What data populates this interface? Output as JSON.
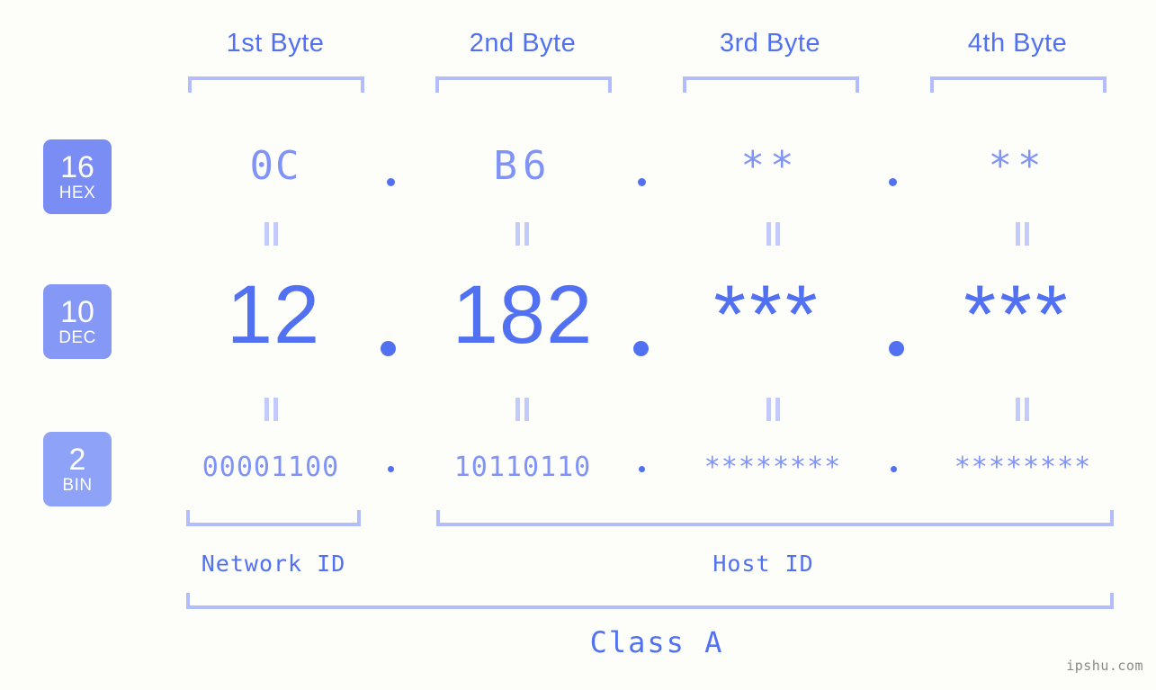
{
  "background_color": "#fdfdfa",
  "accent_color": "#5271f2",
  "muted_accent_color": "#8093f7",
  "bracket_color": "#b3bdfb",
  "headers": {
    "byte1": "1st Byte",
    "byte2": "2nd Byte",
    "byte3": "3rd Byte",
    "byte4": "4th Byte"
  },
  "bases": [
    {
      "number": "16",
      "abbr": "HEX",
      "color": "#7a8df4"
    },
    {
      "number": "10",
      "abbr": "DEC",
      "color": "#8598f6"
    },
    {
      "number": "2",
      "abbr": "BIN",
      "color": "#8ea3f8"
    }
  ],
  "rows": {
    "hex": {
      "label_number": "16",
      "label_abbr": "HEX",
      "values": [
        "0C",
        "B6",
        "**",
        "**"
      ],
      "separator": "."
    },
    "dec": {
      "label_number": "10",
      "label_abbr": "DEC",
      "values": [
        "12",
        "182",
        "***",
        "***"
      ],
      "separator": "."
    },
    "bin": {
      "label_number": "2",
      "label_abbr": "BIN",
      "values": [
        "00001100",
        "10110110",
        "********",
        "********"
      ],
      "separator": "."
    }
  },
  "equals_sign": "=",
  "segments": {
    "network_id": "Network ID",
    "host_id": "Host ID"
  },
  "class_label": "Class A",
  "watermark": "ipshu.com"
}
